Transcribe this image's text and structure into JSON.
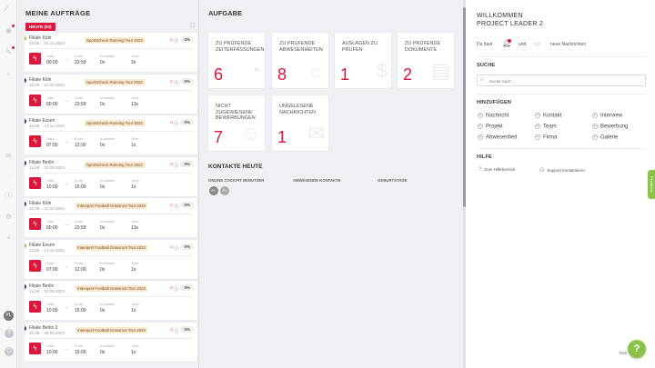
{
  "rail": {
    "icons": [
      "logo-icon",
      "dashboard-icon",
      "orders-icon",
      "search-icon",
      "mail-icon",
      "chat-icon",
      "info-icon",
      "settings-icon",
      "settings-icon",
      "location-icon"
    ],
    "avatar_initials": "PL",
    "help_glyph": "?",
    "logout_glyph": "⏻"
  },
  "orders": {
    "title": "MEINE AUFTRÄGE",
    "filter_label": "HEUTE (53)",
    "labels": {
      "start": "Start",
      "ende": "Ende",
      "kontakte": "Kontakte",
      "jobs": "Jobs"
    },
    "items": [
      {
        "branch": "Filiale Köln",
        "dates": "23.09. - 03.10.2023",
        "tour": "SportScheck Running Tour 2023",
        "pct": "0%",
        "start": "00:00",
        "ende": "23:59",
        "kontakte": "0x",
        "jobs": "3x",
        "color": "#e5b22a"
      },
      {
        "branch": "Filiale Köln",
        "dates": "15.09. - 21.10.2023",
        "tour": "SportScheck Running Tour 2023",
        "pct": "0%",
        "start": "00:00",
        "ende": "23:59",
        "kontakte": "0x",
        "jobs": "13x",
        "color": "#233a8b"
      },
      {
        "branch": "Filiale Essen",
        "dates": "15.08. - 13.12.2022",
        "tour": "SportScheck Running Tour 2023",
        "pct": "0%",
        "start": "07:00",
        "ende": "12:00",
        "kontakte": "0x",
        "jobs": "1x",
        "color": "#233a8b"
      },
      {
        "branch": "Filiale Berlin",
        "dates": "14.06. - 10.09.2023",
        "tour": "SportScheck Running Tour 2023",
        "pct": "0%",
        "start": "10:00",
        "ende": "15:00",
        "kontakte": "0x",
        "jobs": "1x",
        "color": "#233a8b"
      },
      {
        "branch": "Filiale Köln",
        "dates": "15.08. - 21.10.2023",
        "tour": "Intersport Football Grassroot Tour 2023",
        "pct": "0%",
        "start": "00:00",
        "ende": "23:59",
        "kontakte": "0x",
        "jobs": "13x",
        "color": "#233a8b"
      },
      {
        "branch": "Filiale Essen",
        "dates": "23.05. - 13.12.2022",
        "tour": "Intersport Football Grassroot Tour 2023",
        "pct": "0%",
        "start": "07:00",
        "ende": "12:00",
        "kontakte": "0x",
        "jobs": "1x",
        "color": "#8bc34a"
      },
      {
        "branch": "Filiale Berlin",
        "dates": "14.06. - 10.09.2023",
        "tour": "Intersport Football Grassroot Tour 2023",
        "pct": "0%",
        "start": "10:00",
        "ende": "15:00",
        "kontakte": "0x",
        "jobs": "1x",
        "color": "#233a8b"
      },
      {
        "branch": "Filiale Berlin 2",
        "dates": "31.05. - 06.09.2023",
        "tour": "Intersport Football Grassroot Tour 2023",
        "pct": "0%",
        "start": "10:00",
        "ende": "15:00",
        "kontakte": "0x",
        "jobs": "1x",
        "color": "#233a8b"
      }
    ]
  },
  "aufgabe": {
    "title": "AUFGABE",
    "tiles": [
      {
        "label": "ZU PRÜFENDE ZEITERFASSUNGEN",
        "count": "6",
        "icon": "clock-icon",
        "glyph": "◔"
      },
      {
        "label": "ZU PRÜFENDE ABWESENHEITEN",
        "count": "8",
        "icon": "sun-icon",
        "glyph": "☼"
      },
      {
        "label": "AUSLAGEN ZU PRÜFEN",
        "count": "1",
        "icon": "money-icon",
        "glyph": "$"
      },
      {
        "label": "ZU PRÜFENDE DOKUMENTE",
        "count": "2",
        "icon": "document-icon",
        "glyph": "▤"
      },
      {
        "label": "NICHT ZUGEWIESENE BEWERBUNGEN",
        "count": "7",
        "icon": "person-icon",
        "glyph": "☺"
      },
      {
        "label": "UNGELESENE NACHRICHTEN",
        "count": "1",
        "icon": "envelope-icon",
        "glyph": "✉"
      }
    ]
  },
  "kontakte": {
    "title": "KONTAKTE HEUTE",
    "columns": [
      "ONLINE COCKPIT BENUTZER",
      "ABWESENDE KONTAKTE",
      "GEBURTSTAGE"
    ],
    "online_avatars": [
      "PL",
      "PL"
    ]
  },
  "right": {
    "welcome_line1": "WILLKOMMEN",
    "welcome_line2": "PROJECT LEADER 2",
    "du_hast": "Du hast",
    "und": "und",
    "neue_nachrichten": "neue Nachrichten",
    "suche_title": "SUCHE",
    "search_placeholder": "Suche nach ...",
    "hinzufuegen_title": "HINZUFÜGEN",
    "add_items": [
      "Nachricht",
      "Kontakt",
      "Interview",
      "Projekt",
      "Team",
      "Bewerbung",
      "Abwesenheit",
      "Firma",
      "Galerie"
    ],
    "hilfe_title": "HILFE",
    "help_items": [
      "Zum Hilfebereich",
      "Support kontaktieren"
    ],
    "feedback_label": "Feedback",
    "tasks_label": "Task",
    "fab_glyph": "?"
  },
  "colors": {
    "accent": "#d8183c",
    "tour_bg": "#fbe8cf",
    "fab": "#8bc34a"
  }
}
